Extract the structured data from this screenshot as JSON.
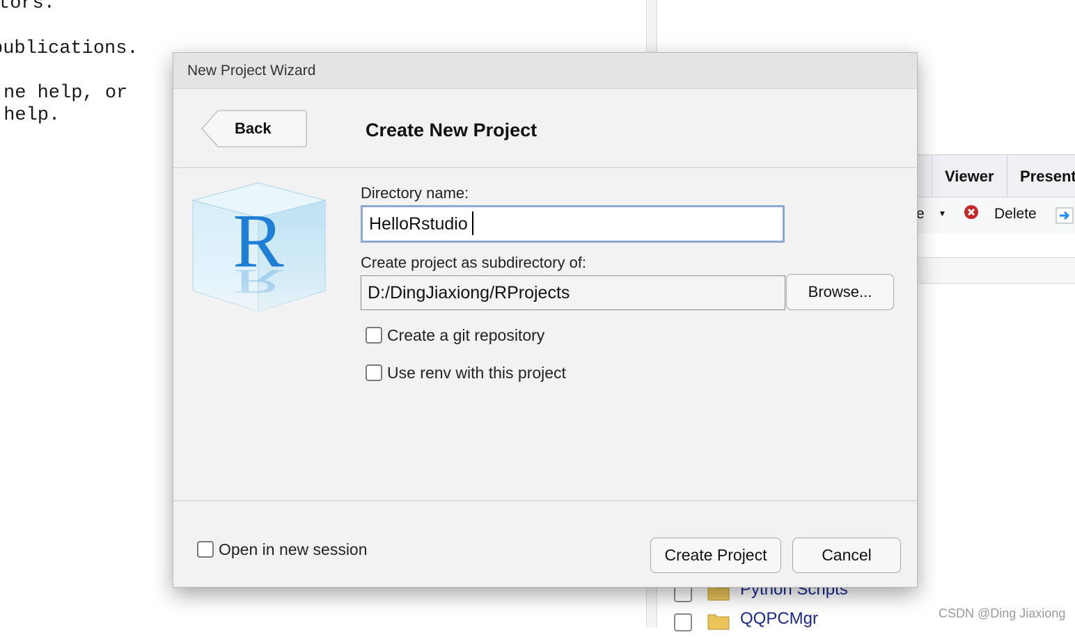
{
  "console": {
    "lines": [
      "tors.",
      "publications.",
      "ne help, or",
      " help."
    ]
  },
  "right_pane": {
    "tabs": [
      "Viewer",
      "Present"
    ],
    "toolbar": {
      "dropdown_fragment": "e",
      "delete_label": "Delete"
    },
    "files": [
      {
        "name": "Python Scripts"
      },
      {
        "name": "QQPCMgr"
      }
    ]
  },
  "dialog": {
    "title": "New Project Wizard",
    "back_label": "Back",
    "heading": "Create New Project",
    "directory_label": "Directory name:",
    "directory_value": "HelloRstudio",
    "subdir_label": "Create project as subdirectory of:",
    "subdir_value": "D:/DingJiaxiong/RProjects",
    "browse_label": "Browse...",
    "git_label": "Create a git repository",
    "renv_label": "Use renv with this project",
    "new_session_label": "Open in new session",
    "create_label": "Create Project",
    "cancel_label": "Cancel",
    "logo_letter": "R",
    "git_checked": false,
    "renv_checked": false,
    "new_session_checked": false
  },
  "watermark": "CSDN @Ding Jiaxiong",
  "colors": {
    "focus_border": "#8aa7d6",
    "link": "#1a2a8f",
    "r_blue": "#1f7fd6"
  }
}
